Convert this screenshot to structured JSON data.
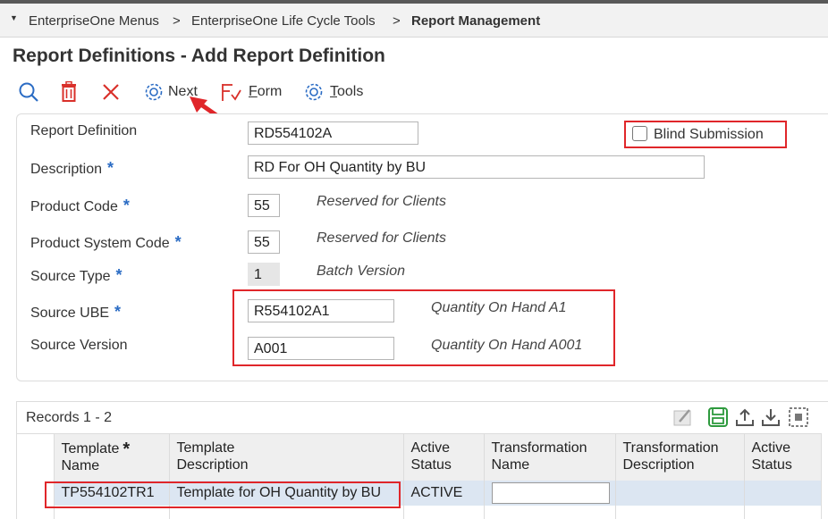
{
  "breadcrumb": {
    "items": [
      "EnterpriseOne Menus",
      "EnterpriseOne Life Cycle Tools",
      "Report Management"
    ],
    "separator": ">"
  },
  "page_title": "Report Definitions - Add Report Definition",
  "toolbar": {
    "next_label": "Next",
    "form_label": "Form",
    "tools_label": "Tools"
  },
  "form": {
    "report_definition": {
      "label": "Report Definition",
      "value": "RD554102A"
    },
    "blind_submission": {
      "label": "Blind Submission",
      "checked": false
    },
    "description": {
      "label": "Description",
      "value": "RD For OH Quantity by BU"
    },
    "product_code": {
      "label": "Product Code",
      "value": "55",
      "hint": "Reserved for Clients"
    },
    "product_system_code": {
      "label": "Product System Code",
      "value": "55",
      "hint": "Reserved for Clients"
    },
    "source_type": {
      "label": "Source Type",
      "value": "1",
      "hint": "Batch Version"
    },
    "source_ube": {
      "label": "Source UBE",
      "value": "R554102A1",
      "hint": "Quantity On Hand A1"
    },
    "source_version": {
      "label": "Source Version",
      "value": "A001",
      "hint": "Quantity On Hand A001"
    },
    "required_marker": "*"
  },
  "grid": {
    "records_label": "Records 1 - 2",
    "columns": [
      {
        "line1": "Template",
        "line2": "Name"
      },
      {
        "line1": "Template",
        "line2": "Description"
      },
      {
        "line1": "Active",
        "line2": "Status"
      },
      {
        "line1": "Transformation",
        "line2": "Name"
      },
      {
        "line1": "Transformation",
        "line2": "Description"
      },
      {
        "line1": "Active",
        "line2": "Status"
      }
    ],
    "required_marker": "*",
    "rows": [
      {
        "template_name": "TP554102TR1",
        "template_description": "Template for OH Quantity by BU",
        "active_status": "ACTIVE",
        "transformation_name": "",
        "transformation_description": "",
        "active_status_2": ""
      }
    ]
  },
  "colors": {
    "highlight_red": "#e0262a",
    "required_blue": "#2b6cc4",
    "selected_row": "#dce6f2"
  }
}
